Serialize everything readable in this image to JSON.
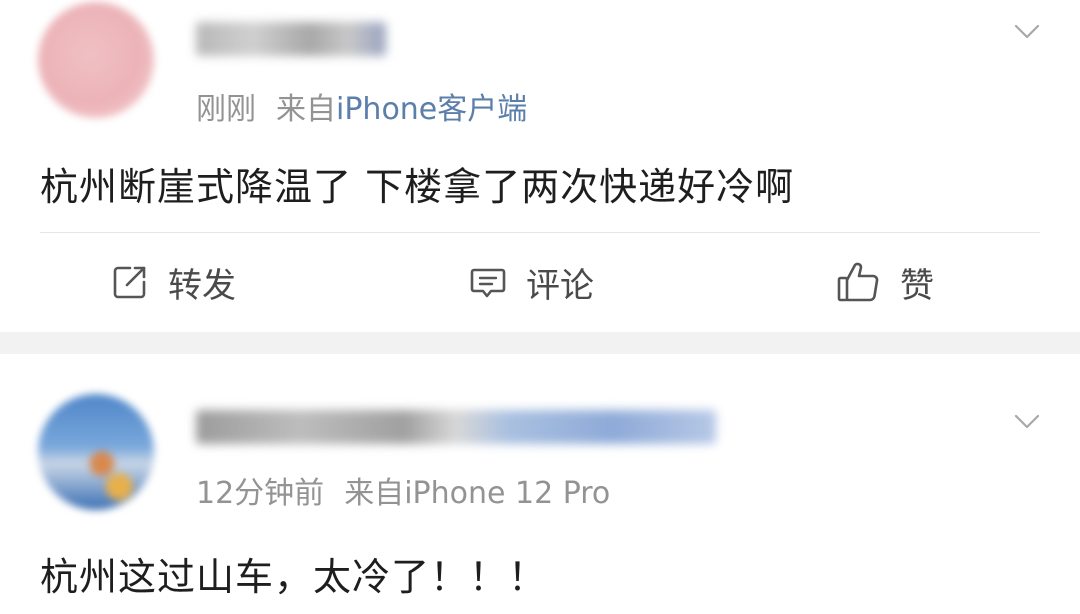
{
  "posts": [
    {
      "time": "刚刚",
      "source_prefix": "来自",
      "source": "iPhone客户端",
      "content": "杭州断崖式降温了 下楼拿了两次快递好冷啊",
      "actions": {
        "repost": "转发",
        "comment": "评论",
        "like": "赞"
      }
    },
    {
      "time": "12分钟前",
      "source_prefix": "来自",
      "source": "iPhone 12 Pro",
      "content": "杭州这过山车，太冷了！！！"
    }
  ],
  "icons": {
    "more": "chevron-down-icon",
    "repost": "edit-share-icon",
    "comment": "comment-bubble-icon",
    "like": "thumbs-up-icon"
  },
  "colors": {
    "source_link": "#5b7faa",
    "meta_text": "#939393",
    "separator": "#f2f2f2"
  }
}
